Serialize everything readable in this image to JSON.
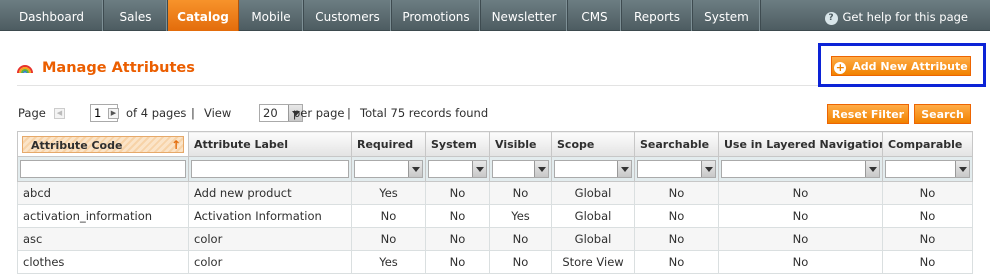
{
  "nav": {
    "items": [
      "Dashboard",
      "Sales",
      "Catalog",
      "Mobile",
      "Customers",
      "Promotions",
      "Newsletter",
      "CMS",
      "Reports",
      "System"
    ],
    "active": "Catalog",
    "help": "Get help for this page"
  },
  "page": {
    "title": "Manage Attributes",
    "add_button": "Add New Attribute"
  },
  "pager": {
    "page_label": "Page",
    "current_page": "1",
    "of_pages": "of 4 pages",
    "sep1": "|",
    "view_label": "View",
    "per_page_value": "20",
    "per_page_label": "per page",
    "sep2": "|",
    "total": "Total 75 records found"
  },
  "actions": {
    "reset_filter": "Reset Filter",
    "search": "Search"
  },
  "grid": {
    "columns": [
      "Attribute Code",
      "Attribute Label",
      "Required",
      "System",
      "Visible",
      "Scope",
      "Searchable",
      "Use in Layered Navigation",
      "Comparable"
    ],
    "rows": [
      [
        "abcd",
        "Add new product",
        "Yes",
        "No",
        "No",
        "Global",
        "No",
        "No",
        "No"
      ],
      [
        "activation_information",
        "Activation Information",
        "No",
        "No",
        "Yes",
        "Global",
        "No",
        "No",
        "No"
      ],
      [
        "asc",
        "color",
        "No",
        "No",
        "No",
        "Global",
        "No",
        "No",
        "No"
      ],
      [
        "clothes",
        "color",
        "Yes",
        "No",
        "No",
        "Store View",
        "No",
        "No",
        "No"
      ]
    ]
  },
  "colors": {
    "accent": "#eb5e00",
    "button": "#f18200",
    "highlight_box": "#0c23d6"
  },
  "icons": {
    "title": "rainbow-icon",
    "help": "help-icon",
    "add": "plus-icon"
  }
}
